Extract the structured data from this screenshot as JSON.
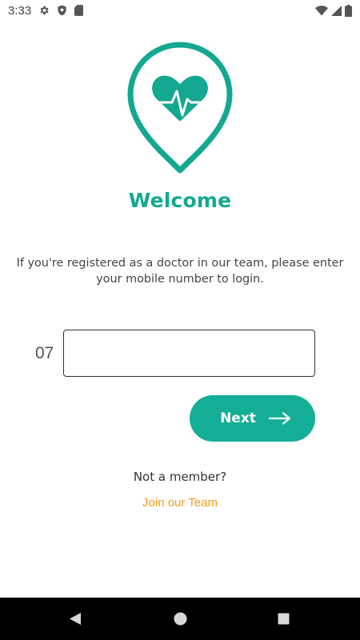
{
  "status_bar": {
    "time": "3:33",
    "left_icons": [
      "settings-gear-icon",
      "shield-icon",
      "sd-card-icon"
    ],
    "right_icons": [
      "wifi-icon",
      "cell-signal-icon",
      "battery-icon"
    ]
  },
  "colors": {
    "brand": "#14a890",
    "button": "#14ad95",
    "link": "#f39c12",
    "nav_bar": "#000000"
  },
  "logo": {
    "icon": "map-pin-heart-pulse-icon"
  },
  "welcome": {
    "title": "Welcome"
  },
  "login": {
    "intro": "If you're registered as a doctor in our team, please enter your mobile number to login.",
    "phone_prefix": "07",
    "phone_value": "",
    "next_label": "Next",
    "next_icon": "arrow-right-icon"
  },
  "signup": {
    "prompt": "Not a member?",
    "link_label": "Join our Team"
  },
  "nav": {
    "back_icon": "back-triangle-icon",
    "home_icon": "home-circle-icon",
    "recents_icon": "recents-square-icon"
  }
}
